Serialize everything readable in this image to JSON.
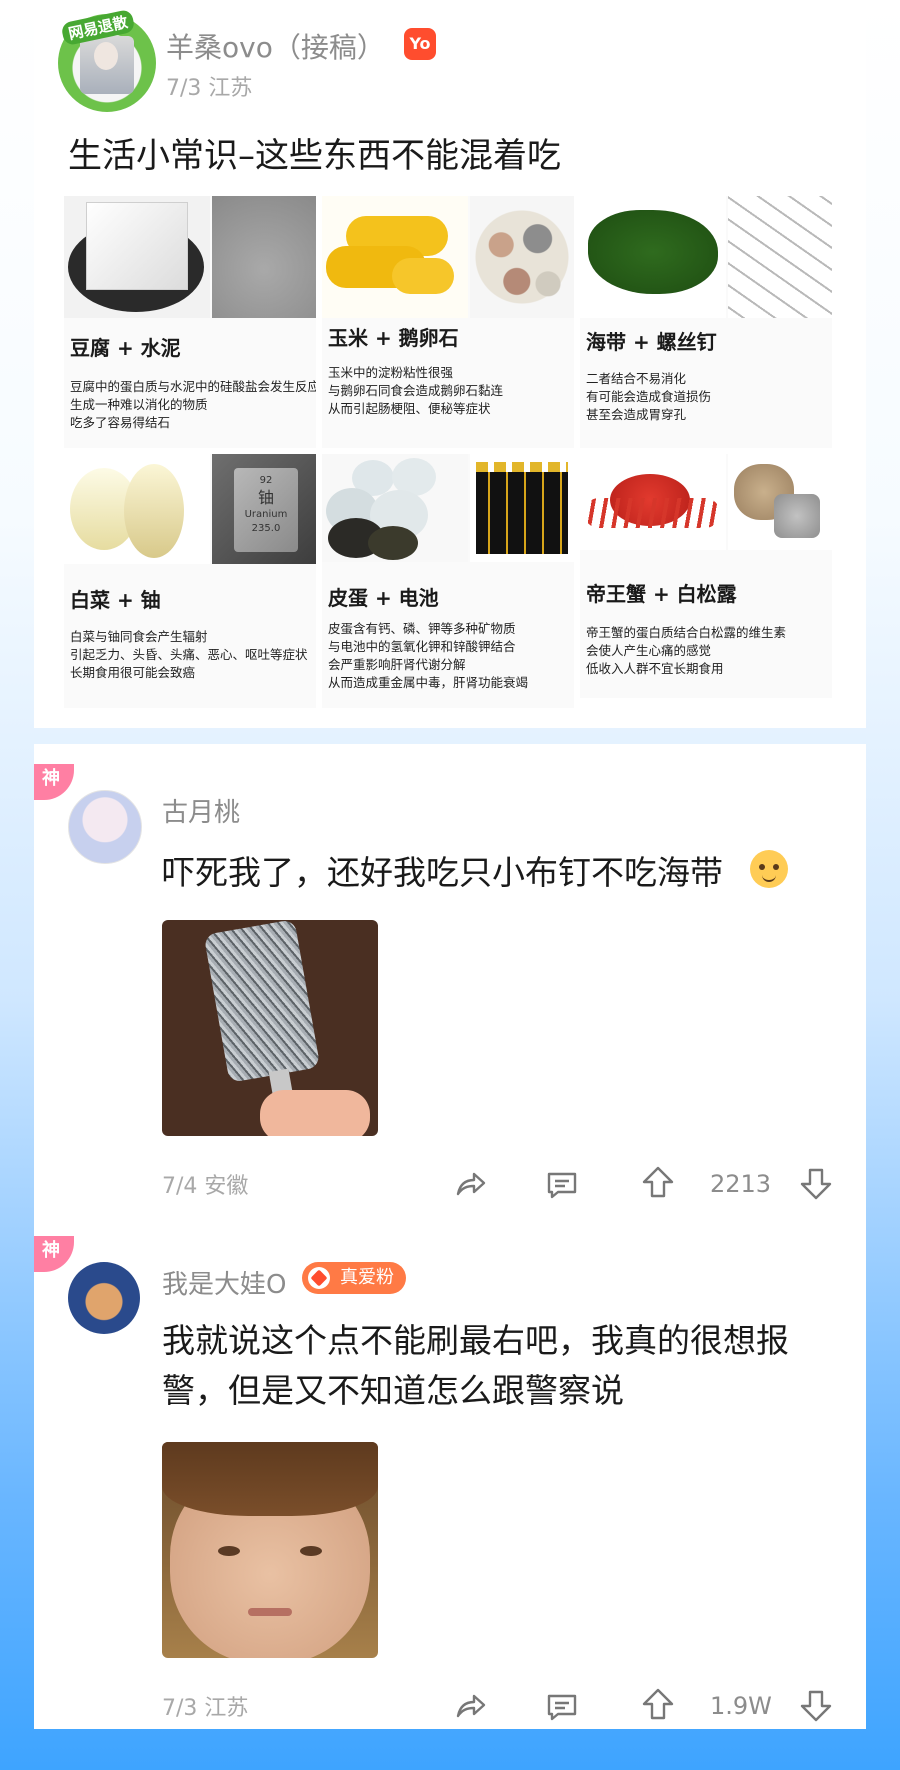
{
  "post": {
    "author": "羊桑ovo（接稿）",
    "vip_badge": "Yo",
    "avatar_badge": "网易退散",
    "meta": "7/3 江苏",
    "title": "生活小常识–这些东西不能混着吃"
  },
  "grid": [
    {
      "name": "豆腐 + 水泥",
      "desc": [
        "豆腐中的蛋白质与水泥中的硅酸盐会发生反应",
        "生成一种难以消化的物质",
        "吃多了容易得结石"
      ]
    },
    {
      "name": "玉米 + 鹅卵石",
      "desc": [
        "玉米中的淀粉粘性很强",
        "与鹅卵石同食会造成鹅卵石黏连",
        "从而引起肠梗阻、便秘等症状"
      ]
    },
    {
      "name": "海带 + 螺丝钉",
      "desc": [
        "二者结合不易消化",
        "有可能会造成食道损伤",
        "甚至会造成胃穿孔"
      ]
    },
    {
      "name": "白菜 + 铀",
      "img_label": [
        "92",
        "铀",
        "Uranium",
        "235.0"
      ],
      "desc": [
        "白菜与铀同食会产生辐射",
        "引起乏力、头昏、头痛、恶心、呕吐等症状",
        "长期食用很可能会致癌"
      ]
    },
    {
      "name": "皮蛋 + 电池",
      "desc": [
        "皮蛋含有钙、磷、钾等多种矿物质",
        "与电池中的氢氧化钾和锌酸钾结合",
        "会严重影响肝肾代谢分解",
        "从而造成重金属中毒，肝肾功能衰竭"
      ]
    },
    {
      "name": "帝王蟹 + 白松露",
      "desc": [
        "帝王蟹的蛋白质结合白松露的维生素",
        "会使人产生心痛的感觉",
        "低收入人群不宜长期食用"
      ]
    }
  ],
  "comments": [
    {
      "sticker": "神",
      "name": "古月桃",
      "text": "吓死我了，还好我吃只小布钉不吃海带",
      "meta": "7/4 安徽",
      "count": "2213"
    },
    {
      "sticker": "神",
      "name": "我是大娃O",
      "badge": "真爱粉",
      "text": "我就说这个点不能刷最右吧，我真的很想报警，但是又不知道怎么跟警察说",
      "meta": "7/3 江苏",
      "count": "1.9W"
    }
  ],
  "icons": {
    "share": "share-icon",
    "comment": "comment-icon",
    "upvote": "upvote-icon",
    "downvote": "downvote-icon"
  },
  "colors": {
    "sticker": "#ff7fa3",
    "vip": "#ff4d2e",
    "fan_badge": "#ff7a45",
    "text_gray": "#8c8c8c"
  }
}
